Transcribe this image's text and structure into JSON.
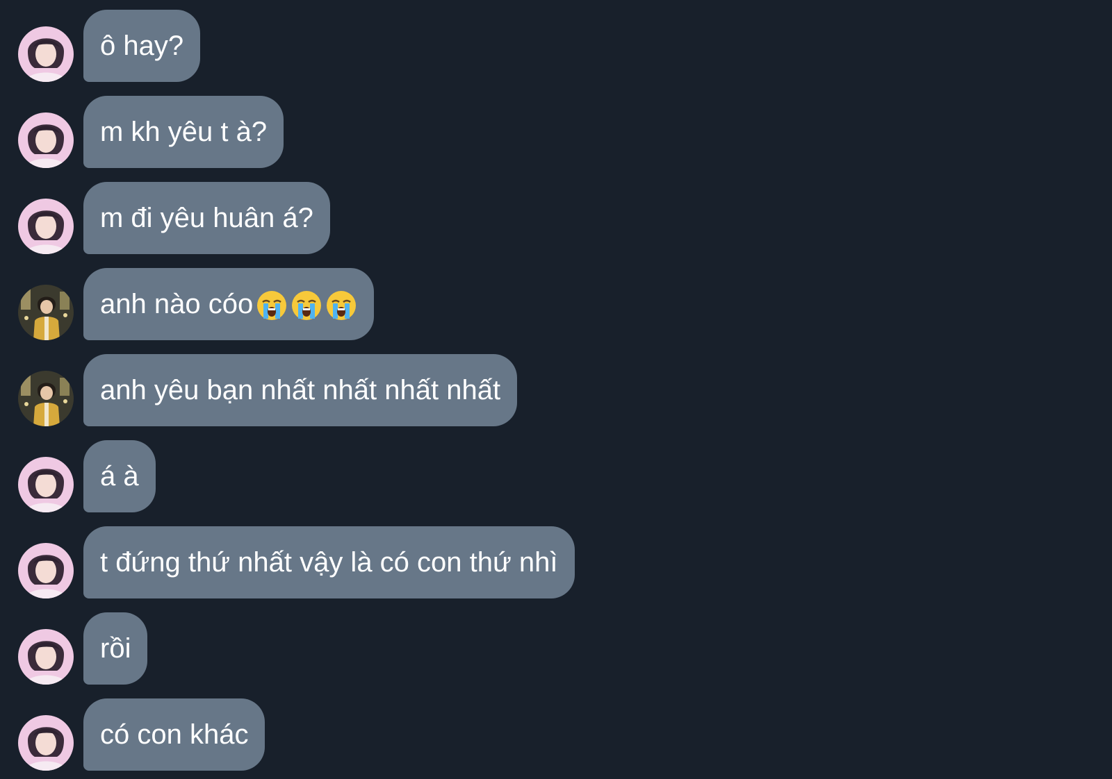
{
  "chat": {
    "messages": [
      {
        "text": "ô hay?",
        "sender": "girl",
        "emoji": []
      },
      {
        "text": "m kh yêu t à?",
        "sender": "girl",
        "emoji": []
      },
      {
        "text": "m đi yêu huân á?",
        "sender": "girl",
        "emoji": []
      },
      {
        "text": "anh nào cóo",
        "sender": "boy",
        "emoji": [
          "loudly-crying-face-icon",
          "loudly-crying-face-icon",
          "loudly-crying-face-icon"
        ]
      },
      {
        "text": "anh yêu bạn nhất nhất nhất nhất",
        "sender": "boy",
        "emoji": []
      },
      {
        "text": "á à",
        "sender": "girl",
        "emoji": []
      },
      {
        "text": "t đứng thứ nhất vậy là có con thứ nhì",
        "sender": "girl",
        "emoji": []
      },
      {
        "text": "rồi",
        "sender": "girl",
        "emoji": []
      },
      {
        "text": "có con khác",
        "sender": "girl",
        "emoji": []
      }
    ]
  },
  "colors": {
    "background": "#18202b",
    "bubble": "#677788",
    "text": "#ffffff"
  }
}
